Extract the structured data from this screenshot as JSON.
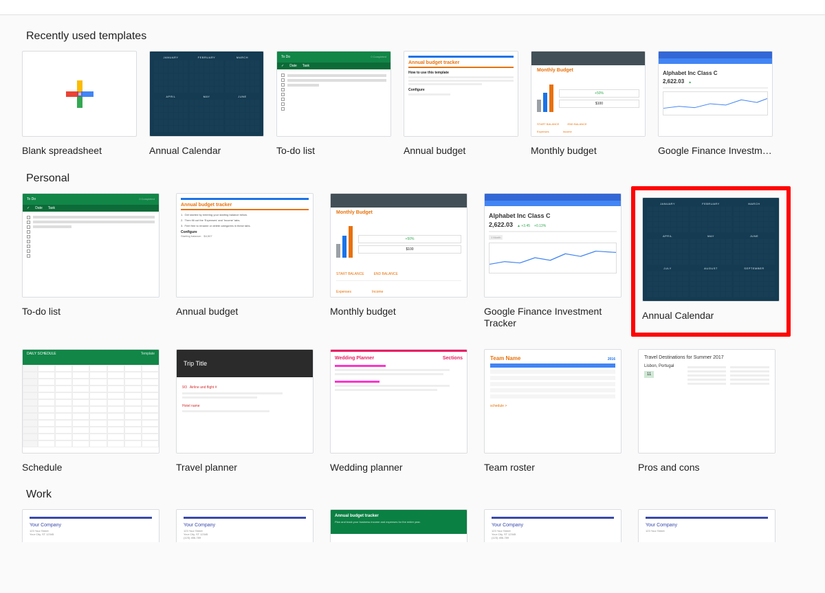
{
  "sections": {
    "recent_title": "Recently used templates",
    "personal_title": "Personal",
    "work_title": "Work"
  },
  "recent": [
    {
      "label": "Blank spreadsheet"
    },
    {
      "label": "Annual Calendar"
    },
    {
      "label": "To-do list"
    },
    {
      "label": "Annual budget"
    },
    {
      "label": "Monthly budget"
    },
    {
      "label": "Google Finance Investment Tracker"
    }
  ],
  "personal_row1": [
    {
      "label": "To-do list"
    },
    {
      "label": "Annual budget"
    },
    {
      "label": "Monthly budget"
    },
    {
      "label": "Google Finance Investment Tracker"
    },
    {
      "label": "Annual Calendar"
    }
  ],
  "personal_row2": [
    {
      "label": "Schedule"
    },
    {
      "label": "Travel planner"
    },
    {
      "label": "Wedding planner"
    },
    {
      "label": "Team roster"
    },
    {
      "label": "Pros and cons"
    }
  ],
  "work": [
    {
      "label": ""
    },
    {
      "label": ""
    },
    {
      "label": ""
    },
    {
      "label": ""
    },
    {
      "label": ""
    }
  ],
  "thumbs": {
    "todo_title": "To Do",
    "todo_cols": [
      "✓",
      "Date",
      "Task"
    ],
    "annual_budget_title": "Annual budget tracker",
    "monthly_budget_title": "Monthly Budget",
    "monthly_stat1": "+50%",
    "monthly_stat2": "$100",
    "gf_name": "Alphabet Inc Class C",
    "gf_price": "2,622.03",
    "travel_title": "Trip Title",
    "wedding_title": "Wedding Planner",
    "wedding_sec": "Sections",
    "roster_name": "Team Name",
    "roster_year": "2016",
    "pros_title": "Travel Destinations for Summer 2017",
    "pros_city": "Lisbon, Portugal",
    "pros_num": "11",
    "company_name": "Your Company",
    "gbudget_title": "Annual budget tracker",
    "cal_months": [
      "JANUARY",
      "FEBRUARY",
      "MARCH",
      "APRIL",
      "MAY",
      "JUNE",
      "JULY",
      "AUGUST",
      "SEPTEMBER"
    ]
  }
}
